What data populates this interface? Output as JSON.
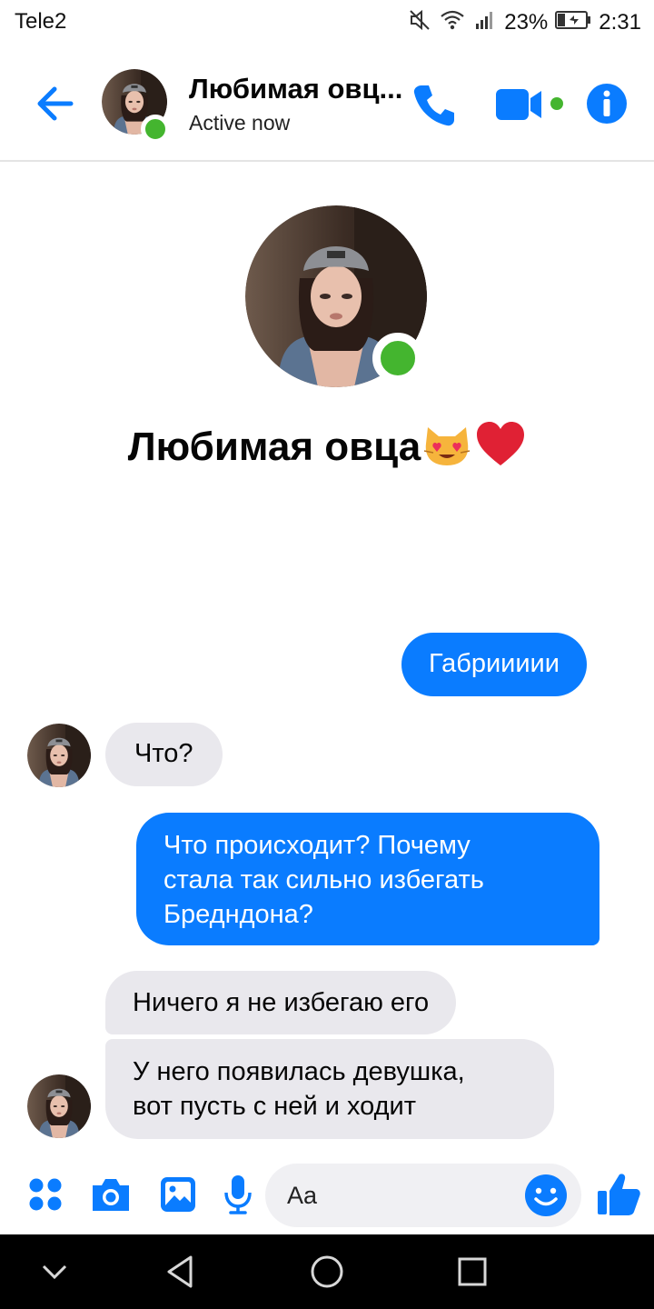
{
  "status_bar": {
    "carrier": "Tele2",
    "battery": "23%",
    "time": "2:31"
  },
  "header": {
    "name": "Любимая овц...",
    "status": "Active now"
  },
  "profile": {
    "name": "Любимая овца",
    "emojis": [
      "smiling-cat-heart-eyes",
      "red-heart"
    ]
  },
  "messages": [
    {
      "from": "me",
      "text": "Габриииии"
    },
    {
      "from": "them",
      "text": "Что?"
    },
    {
      "from": "me",
      "lines": [
        "Что происходит? Почему",
        "стала так сильно избегать",
        "Бредндона?"
      ]
    },
    {
      "from": "them",
      "text": "Ничего я не избегаю его"
    },
    {
      "from": "them",
      "lines": [
        "У него появилась девушка,",
        "вот пусть с ней и ходит"
      ]
    }
  ],
  "composer": {
    "placeholder": "Aa"
  },
  "colors": {
    "accent": "#0a7cff",
    "online": "#44b52f",
    "incoming_bubble": "#e9e8ed"
  }
}
